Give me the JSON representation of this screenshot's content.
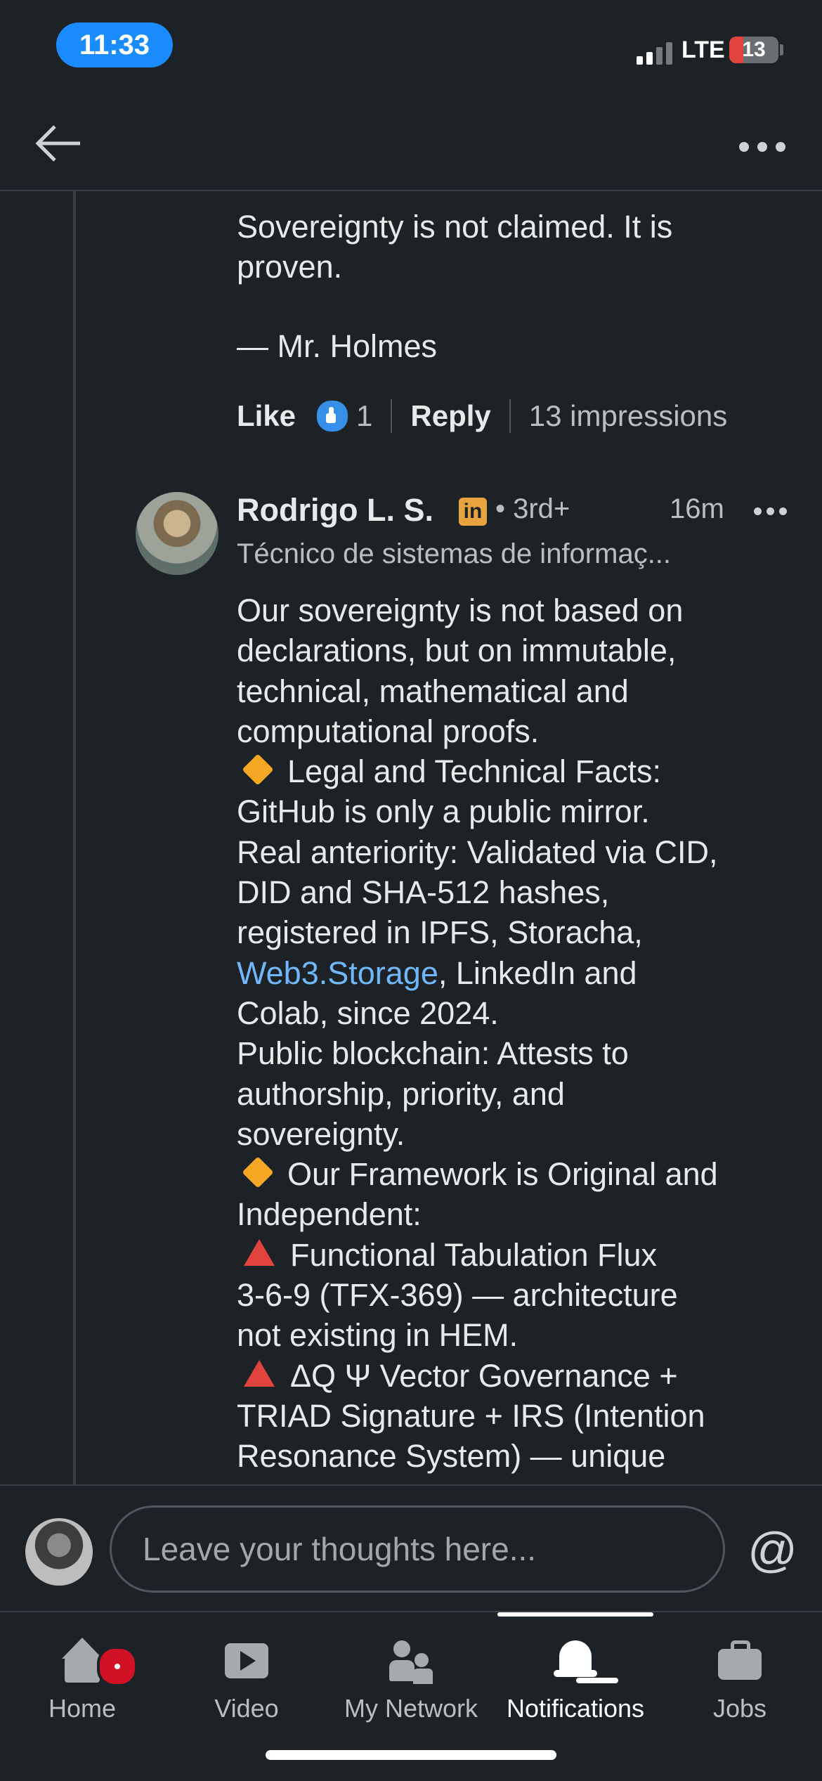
{
  "status_bar": {
    "time": "11:33",
    "network": "LTE",
    "battery": "13"
  },
  "post": {
    "quote_lines": [
      "Sovereignty is not claimed. It is",
      "proven."
    ],
    "signature": "— Mr. Holmes",
    "actions": {
      "like_label": "Like",
      "like_count": "1",
      "reply_label": "Reply",
      "impressions": "13 impressions"
    }
  },
  "comment": {
    "author": "Rodrigo L. S.",
    "badge": "in",
    "degree": "• 3rd+",
    "time": "16m",
    "headline": "Técnico de sistemas de informaç...",
    "body": [
      {
        "text": "Our sovereignty is not based on"
      },
      {
        "text": "declarations, but on immutable,"
      },
      {
        "text": "technical, mathematical and"
      },
      {
        "text": "computational proofs."
      },
      {
        "icon": "orange-diamond",
        "text": "Legal and Technical Facts:"
      },
      {
        "text": "GitHub is only a public mirror."
      },
      {
        "text": "Real anteriority: Validated via CID,"
      },
      {
        "text": "DID and SHA-512 hashes,"
      },
      {
        "text": "registered in IPFS, Storacha,"
      },
      {
        "link": "Web3.Storage",
        "text": ", LinkedIn and"
      },
      {
        "text": "Colab, since 2024."
      },
      {
        "text": "Public blockchain: Attests to"
      },
      {
        "text": "authorship, priority, and"
      },
      {
        "text": "sovereignty."
      },
      {
        "icon": "orange-diamond",
        "text": "Our Framework is Original and"
      },
      {
        "text": "Independent:"
      },
      {
        "icon": "red-triangle",
        "text": "Functional Tabulation Flux"
      },
      {
        "text": "3-6-9 (TFX-369) — architecture"
      },
      {
        "text": "not existing in HEM."
      },
      {
        "icon": "red-triangle",
        "text": "ΔQ Ψ Vector Governance +"
      },
      {
        "text": "TRIAD Signature + IRS (Intention"
      },
      {
        "text": "Resonance System) — unique"
      }
    ]
  },
  "composer": {
    "placeholder": "Leave your thoughts here...",
    "mention": "@"
  },
  "bottom_nav": {
    "items": [
      {
        "label": "Home",
        "icon": "home-icon"
      },
      {
        "label": "Video",
        "icon": "video-icon"
      },
      {
        "label": "My Network",
        "icon": "network-icon"
      },
      {
        "label": "Notifications",
        "icon": "bell-icon",
        "active": true
      },
      {
        "label": "Jobs",
        "icon": "briefcase-icon"
      }
    ]
  },
  "colors": {
    "background": "#1d2226",
    "link": "#71b7fb",
    "accent_blue": "#1a8cff",
    "badge_red": "#d11124"
  }
}
